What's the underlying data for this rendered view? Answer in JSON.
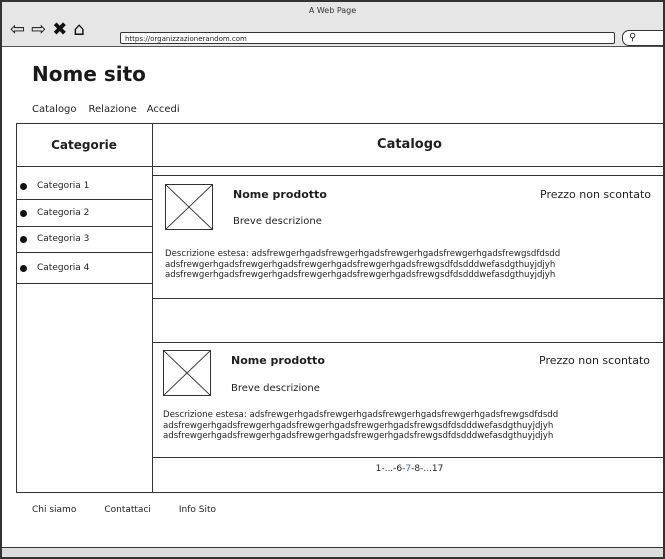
{
  "window": {
    "title": "A Web Page",
    "url": "https://organizzazionerandom.com"
  },
  "header": {
    "site_name": "Nome sito",
    "nav": [
      "Catalogo",
      "Relazione",
      "Accedi"
    ]
  },
  "sidebar": {
    "title": "Categorie",
    "items": [
      "Categoria 1",
      "Categoria 2",
      "Categoria 3",
      "Categoria 4"
    ]
  },
  "main": {
    "title": "Catalogo",
    "products": [
      {
        "name": "Nome prodotto",
        "short": "Breve descrizione",
        "price": "Prezzo non scontato",
        "desc_lines": [
          "Descrizione estesa: adsfrewgerhgadsfrewgerhgadsfrewgerhgadsfrewgerhgadsfrewgsdfdsdd",
          "adsfrewgerhgadsfrewgerhgadsfrewgerhgadsfrewgerhgadsfrewgsdfdsdddwefasdgthuyjdjyh",
          "adsfrewgerhgadsfrewgerhgadsfrewgerhgadsfrewgerhgadsfrewgsdfdsdddwefasdgthuyjdjyh"
        ]
      },
      {
        "name": "Nome prodotto",
        "short": "Breve descrizione",
        "price": "Prezzo non scontato",
        "desc_lines": [
          "Descrizione estesa: adsfrewgerhgadsfrewgerhgadsfrewgerhgadsfrewgerhgadsfrewgsdfdsdd",
          "adsfrewgerhgadsfrewgerhgadsfrewgerhgadsfrewgerhgadsfrewgsdfdsdddwefasdgthuyjdjyh",
          "adsfrewgerhgadsfrewgerhgadsfrewgerhgadsfrewgerhgadsfrewgsdfdsdddwefasdgthuyjdjyh"
        ]
      }
    ],
    "pagination": {
      "prefix": "1-...-6-",
      "current": "7",
      "suffix": "-8-...17"
    }
  },
  "footer": {
    "links": [
      "Chi siamo",
      "Contattaci",
      "Info Sito"
    ]
  }
}
